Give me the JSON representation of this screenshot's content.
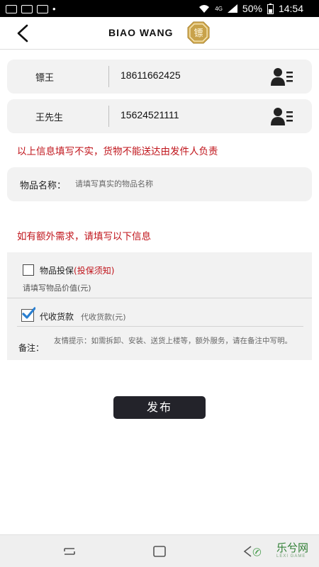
{
  "status_bar": {
    "battery": "50%",
    "time": "14:54",
    "network": "4G"
  },
  "header": {
    "title": "BIAO WANG",
    "logo_char": "镖"
  },
  "contacts": [
    {
      "name": "镖王",
      "phone": "18611662425"
    },
    {
      "name": "王先生",
      "phone": "15624521111"
    }
  ],
  "warning_text": "以上信息填写不实，货物不能送达由发件人负责",
  "item": {
    "label": "物品名称：",
    "placeholder": "请填写真实的物品名称"
  },
  "extra_title": "如有额外需求，请填写以下信息",
  "insurance": {
    "label": "物品投保",
    "link": "(投保须知)",
    "checked": false,
    "value_placeholder": "请填写物品价值(元)"
  },
  "cod": {
    "label": "代收货款",
    "placeholder": "代收货款(元)",
    "checked": true
  },
  "remark": {
    "label": "备注：",
    "hint": "友情提示：如需拆卸、安装、送货上楼等，额外服务，请在备注中写明。"
  },
  "publish_label": "发布",
  "watermark": {
    "text": "乐兮网",
    "sub": "LEXI GAME"
  },
  "colors": {
    "warning": "#c0141b",
    "button": "#23232a",
    "check": "#2a7fd0",
    "logo": "#c8a24a"
  }
}
